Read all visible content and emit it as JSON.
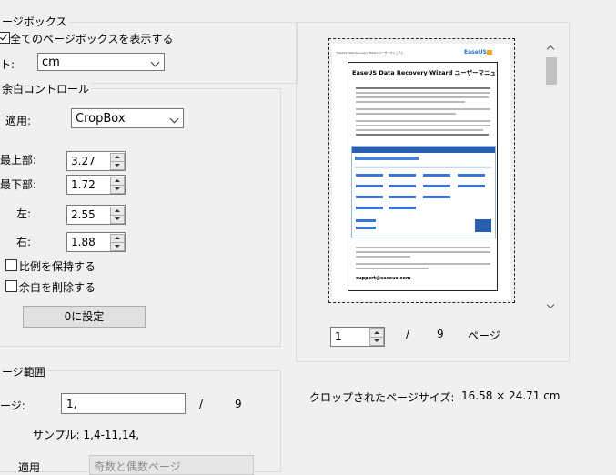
{
  "page_box": {
    "group_title": "ージボックス",
    "show_all_label": "全てのページボックスを表示する",
    "show_all_checked": true,
    "unit_label": "ト:",
    "unit_value": "cm"
  },
  "margin_control": {
    "group_title": "余白コントロール",
    "apply_label": "適用:",
    "apply_value": "CropBox",
    "top_label": "最上部:",
    "top_value": "3.27",
    "bottom_label": "最下部:",
    "bottom_value": "1.72",
    "left_label": "左:",
    "left_value": "2.55",
    "right_label": "右:",
    "right_value": "1.88",
    "keep_ratio_label": "比例を保持する",
    "remove_margin_label": "余白を削除する",
    "zero_button": "0に設定"
  },
  "preview": {
    "doc_header_left": "EaseUS Data Recovery Wizard ユーザーマニュアル",
    "doc_logo": "EaseUS",
    "doc_title": "EaseUS Data Recovery Wizard ユーザーマニュアル",
    "doc_footer": "support@easeus.com",
    "page_current": "1",
    "page_sep": "/",
    "page_total": "9",
    "page_unit": "ページ"
  },
  "page_range": {
    "group_title": "ージ範囲",
    "pages_label": "ージ:",
    "pages_value": "1,",
    "pages_sep": "/",
    "pages_total": "9",
    "sample_label": "サンプル: 1,4-11,14,",
    "apply_partial_label": "適用",
    "apply_partial_value": "奇数と偶数ページ"
  },
  "crop_size": {
    "label": "クロップされたページサイズ:",
    "value": "16.58 × 24.71 cm"
  }
}
